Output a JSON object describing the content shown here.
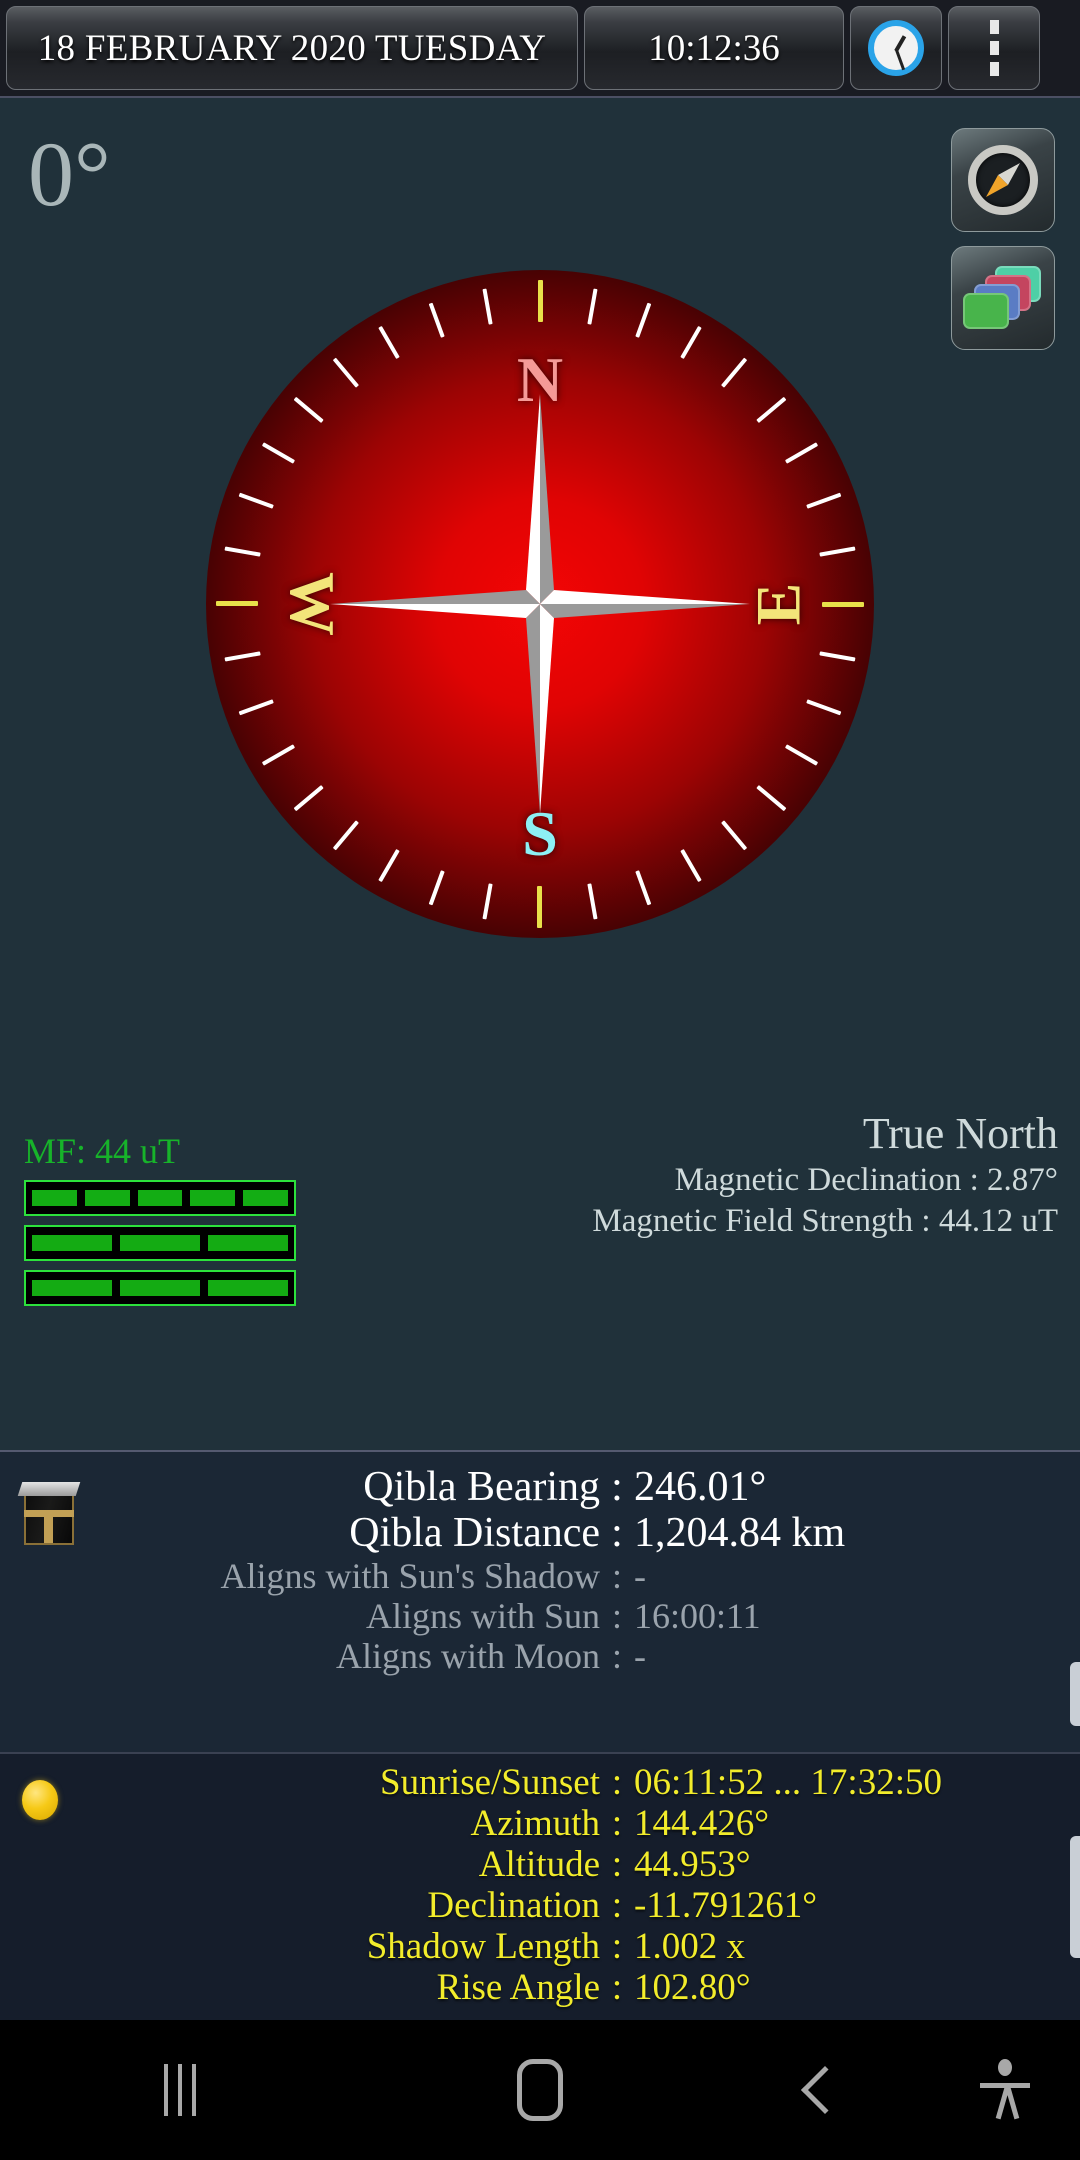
{
  "topbar": {
    "date": "18 FEBRUARY 2020  TUESDAY",
    "time": "10:12:36",
    "clock_icon": "clock-icon",
    "menu_icon": "overflow-menu-icon"
  },
  "compass": {
    "heading": "0°",
    "north_label": "North",
    "north_marker_color": "#14e214",
    "cardinals": {
      "n": "N",
      "e": "E",
      "s": "S",
      "w": "W"
    },
    "dial_color_center": "#f40505",
    "dial_color_edge": "#0b0102",
    "buttons": {
      "needle_icon": "compass-needle-icon",
      "theme_icon": "theme-cards-icon"
    }
  },
  "magnetic_field": {
    "label": "MF: 44 uT",
    "color": "#17b32a",
    "bars": [
      5,
      3,
      3
    ]
  },
  "true_north": {
    "title": "True North",
    "lines": [
      "Magnetic Declination : 2.87°",
      "Magnetic Field Strength : 44.12 uT"
    ]
  },
  "qibla": {
    "icon": "kaaba-icon",
    "rows": [
      {
        "label": "Qibla Bearing",
        "sep": ":",
        "value": "246.01°",
        "style": "q-bright q-big"
      },
      {
        "label": "Qibla Distance",
        "sep": ":",
        "value": "1,204.84 km",
        "style": "q-bright q-big"
      },
      {
        "label": "Aligns with Sun's Shadow",
        "sep": ":",
        "value": "-",
        "style": "q-dim q-sm"
      },
      {
        "label": "Aligns with Sun",
        "sep": ":",
        "value": "16:00:11",
        "style": "q-dim q-sm"
      },
      {
        "label": "Aligns with Moon",
        "sep": ":",
        "value": "-",
        "style": "q-dim q-sm"
      }
    ]
  },
  "sun": {
    "icon": "sun-icon",
    "color": "#f2ec2b",
    "rows": [
      {
        "label": "Sunrise/Sunset",
        "sep": ":",
        "value": "06:11:52 ... 17:32:50"
      },
      {
        "label": "Azimuth",
        "sep": ":",
        "value": "144.426°"
      },
      {
        "label": "Altitude",
        "sep": ":",
        "value": "44.953°"
      },
      {
        "label": "Declination",
        "sep": ":",
        "value": "-11.791261°"
      },
      {
        "label": "Shadow Length",
        "sep": ":",
        "value": "1.002 x"
      },
      {
        "label": "Rise Angle",
        "sep": ":",
        "value": "102.80°"
      }
    ]
  },
  "navbar": {
    "recents_icon": "recents-icon",
    "home_icon": "home-icon",
    "back_icon": "back-icon",
    "accessibility_icon": "accessibility-icon"
  }
}
